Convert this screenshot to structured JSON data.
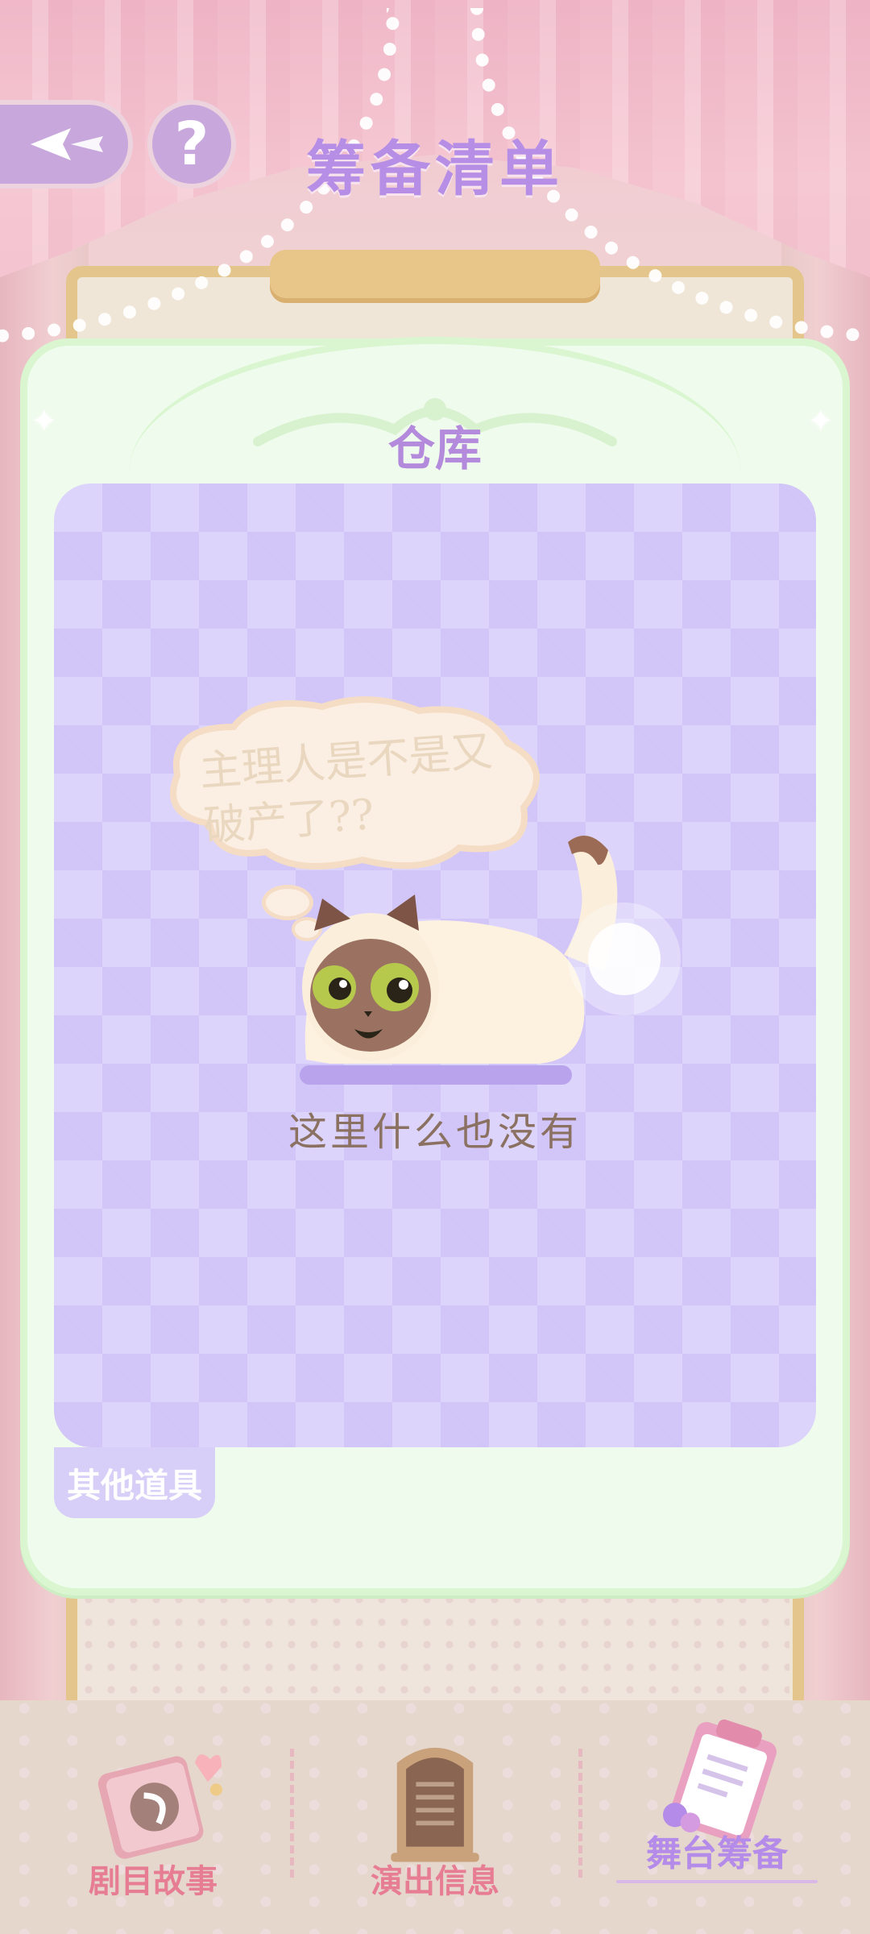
{
  "header": {
    "title": "筹备清单",
    "help_label": "?"
  },
  "panel": {
    "title": "仓库",
    "bubble_text": "主理人是不是又破产了??",
    "empty_text": "这里什么也没有",
    "tab_label": "其他道具"
  },
  "nav": {
    "items": [
      {
        "label": "剧目故事",
        "icon": "storybook-icon"
      },
      {
        "label": "演出信息",
        "icon": "info-board-icon"
      },
      {
        "label": "舞台筹备",
        "icon": "clipboard-icon"
      }
    ]
  },
  "colors": {
    "accent_purple": "#b68ee6",
    "nav_pink": "#e77d93",
    "panel_green": "#effbec"
  }
}
